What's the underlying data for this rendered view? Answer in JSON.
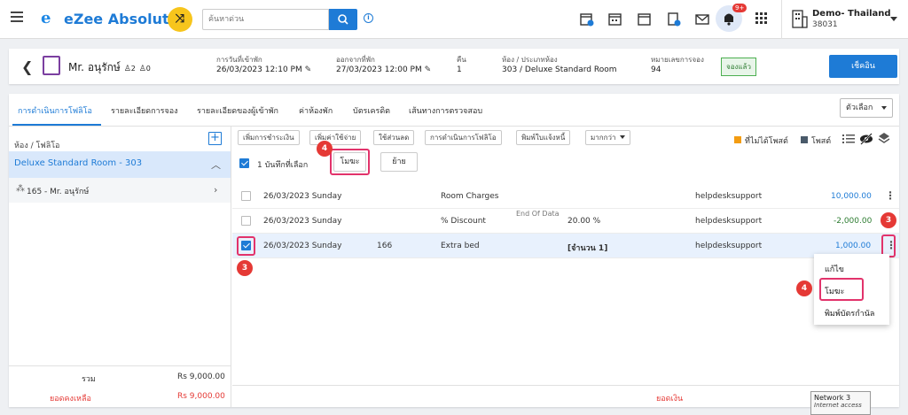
{
  "app": {
    "logo_letter": "e",
    "logo_text": "eZee Absolute",
    "search_placeholder": "ค้นหาด่วน",
    "notif_badge": "9+",
    "hotel_name": "Demo- Thailand",
    "hotel_id": "38031"
  },
  "reservation": {
    "guest_name": "Mr. อนุรักษ์",
    "adults": "2",
    "children": "0",
    "arrival_label": "การวันที่เข้าพัก",
    "arrival_value": "26/03/2023 12:10 PM",
    "departure_label": "ออกจากที่พัก",
    "departure_value": "27/03/2023 12:00 PM",
    "nights_label": "คืน",
    "nights_value": "1",
    "room_label": "ห้อง / ประเภทห้อง",
    "room_value": "303 / Deluxe Standard Room",
    "resno_label": "หมายเลขการจอง",
    "resno_value": "94",
    "status": "จองแล้ว",
    "checkin_button": "เช็คอิน"
  },
  "tabs": [
    "การดำเนินการโฟลิโอ",
    "รายละเอียดการจอง",
    "รายละเอียดของผู้เข้าพัก",
    "ค่าห้องพัก",
    "บัตรเครดิต",
    "เส้นทางการตรวจสอบ"
  ],
  "options_label": "ตัวเลือก",
  "left_panel": {
    "header": "ห้อง / โฟลิโอ",
    "room": "Deluxe Standard Room - 303",
    "folio": "165 - Mr. อนุรักษ์",
    "total_label": "รวม",
    "total_value": "Rs 9,000.00",
    "balance_label": "ยอดคงเหลือ",
    "balance_value": "Rs 9,000.00"
  },
  "toolbar": {
    "buttons": [
      "เพิ่มการชำระเงิน",
      "เพิ่มค่าใช้จ่าย",
      "ใช้ส่วนลด",
      "การดำเนินการโฟลิโอ",
      "พิมพ์ใบแจ้งหนี้",
      "มากกว่า"
    ],
    "legend_unposted": "ที่ไม่ได้โพสต์",
    "legend_posted": "โพสต์",
    "colors": {
      "unposted": "#f39c12",
      "posted": "#4a5a6a",
      "accent": "#1e7bd6",
      "highlight": "#e2336b"
    }
  },
  "selection": {
    "text": "1 บันทึกที่เลือก",
    "void_button": "โมฆะ",
    "move_button": "ย้าย"
  },
  "transactions": [
    {
      "date": "26/03/2023 Sunday",
      "ref": "",
      "desc": "Room Charges",
      "extra": "",
      "user": "helpdesksupport",
      "amount": "10,000.00"
    },
    {
      "date": "26/03/2023 Sunday",
      "ref": "",
      "desc": "% Discount",
      "extra": "20.00 %",
      "user": "helpdesksupport",
      "amount": "-2,000.00"
    },
    {
      "date": "26/03/2023 Sunday",
      "ref": "166",
      "desc": "Extra bed",
      "extra": "[จำนวน 1]",
      "user": "helpdesksupport",
      "amount": "1,000.00"
    }
  ],
  "end_of_data": "End Of Data",
  "payment_label": "ยอดเงิน",
  "context_menu": [
    "แก้ไข",
    "โมฆะ",
    "พิมพ์บัตรกำนัล"
  ],
  "steps": {
    "three": "3",
    "four": "4"
  },
  "tooltip": {
    "title": "Network 3",
    "sub": "Internet access"
  }
}
